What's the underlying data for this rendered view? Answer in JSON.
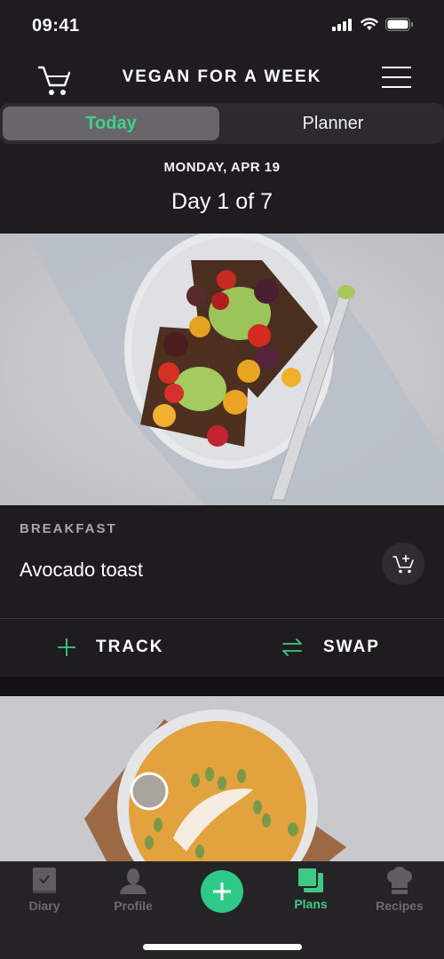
{
  "status_bar": {
    "time": "09:41"
  },
  "header": {
    "title": "VEGAN FOR A WEEK"
  },
  "segmented": {
    "tabs": [
      {
        "label": "Today",
        "active": true
      },
      {
        "label": "Planner",
        "active": false
      }
    ]
  },
  "day_info": {
    "date": "MONDAY, APR 19",
    "day": "Day 1 of 7"
  },
  "meal": {
    "type": "BREAKFAST",
    "name": "Avocado toast",
    "actions": {
      "track": "TRACK",
      "swap": "SWAP"
    }
  },
  "tabbar": {
    "items": [
      {
        "label": "Diary",
        "icon": "diary-icon",
        "active": false
      },
      {
        "label": "Profile",
        "icon": "profile-icon",
        "active": false
      },
      {
        "label": "Plans",
        "icon": "plans-icon",
        "active": true
      },
      {
        "label": "Recipes",
        "icon": "recipes-icon",
        "active": false
      }
    ]
  },
  "colors": {
    "accent": "#3fd08a",
    "background": "#1f1c1f",
    "tabbar": "#252326"
  }
}
